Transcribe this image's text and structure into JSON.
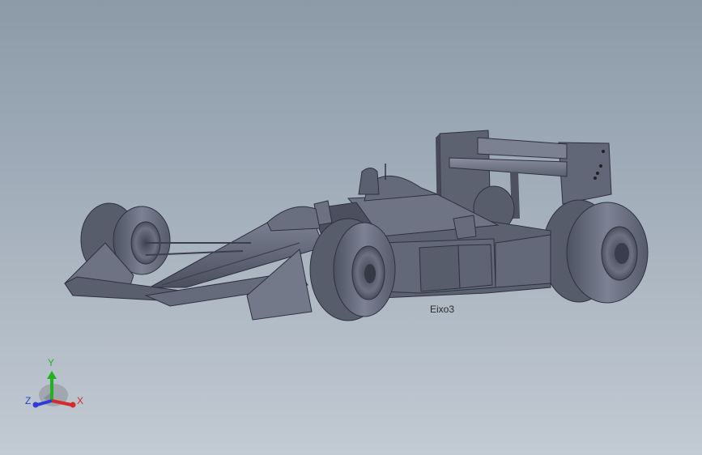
{
  "viewport": {
    "background_top": "#8c9aa8",
    "background_bottom": "#c2cad3",
    "model_color": "#5e6372"
  },
  "annotation": {
    "axis_label": "Eixo3"
  },
  "triad": {
    "x_label": "X",
    "y_label": "Y",
    "z_label": "Z",
    "x_color": "#d42a2a",
    "y_color": "#23b023",
    "z_color": "#2b3dd6"
  }
}
